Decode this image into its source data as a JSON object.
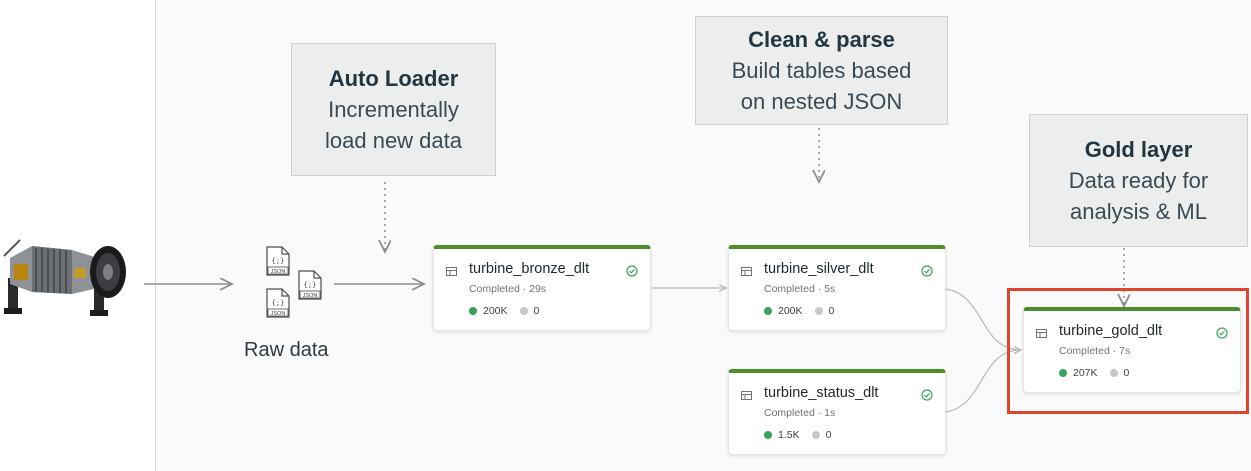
{
  "callouts": {
    "auto_loader": {
      "title": "Auto Loader",
      "line1": "Incrementally",
      "line2": "load new data"
    },
    "clean_parse": {
      "title": "Clean & parse",
      "line1": "Build tables based",
      "line2": "on nested JSON"
    },
    "gold_layer": {
      "title": "Gold layer",
      "line1": "Data ready for",
      "line2": "analysis & ML"
    }
  },
  "raw_data": {
    "label": "Raw data",
    "file_label": "JSON",
    "file_glyph": "{;}"
  },
  "nodes": [
    {
      "name": "turbine_bronze_dlt",
      "status": "Completed · 29s",
      "rows": "200K",
      "dropped": "0"
    },
    {
      "name": "turbine_silver_dlt",
      "status": "Completed · 5s",
      "rows": "200K",
      "dropped": "0"
    },
    {
      "name": "turbine_status_dlt",
      "status": "Completed · 1s",
      "rows": "1.5K",
      "dropped": "0"
    },
    {
      "name": "turbine_gold_dlt",
      "status": "Completed · 7s",
      "rows": "207K",
      "dropped": "0"
    }
  ],
  "colors": {
    "node_accent": "#4f8c2b",
    "highlight": "#e0442c",
    "metric_green": "#3aa35a",
    "metric_grey": "#c6c8ca",
    "callout_bg": "#eceded"
  },
  "icons": [
    "turbine-image",
    "json-file-icon",
    "table-icon",
    "check-circle-icon"
  ]
}
